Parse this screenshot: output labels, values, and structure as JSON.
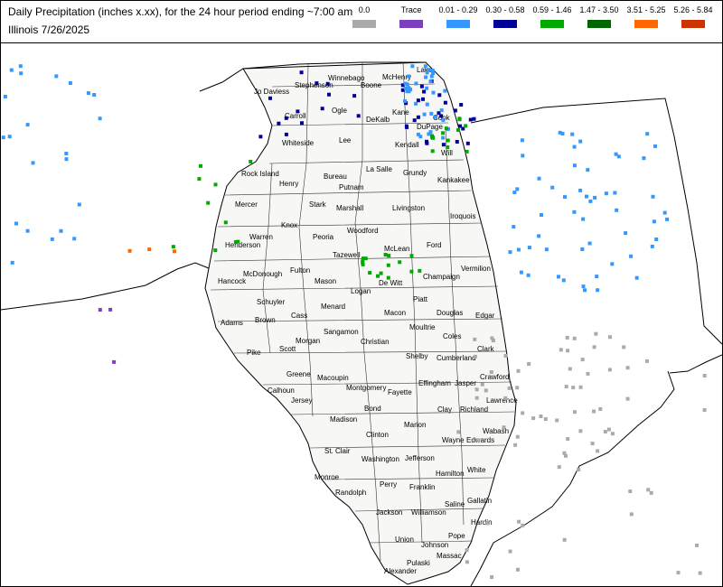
{
  "header": {
    "title": "Daily Precipitation (inches  x.xx),  for the 24 hour period ending ~7:00 am",
    "subtitle": "Illinois 7/26/2025"
  },
  "legend": [
    {
      "label": "0.0",
      "color": "#aaaaaa"
    },
    {
      "label": "Trace",
      "color": "#7b3fbf"
    },
    {
      "label": "0.01 - 0.29",
      "color": "#3399ff"
    },
    {
      "label": "0.30 - 0.58",
      "color": "#000099"
    },
    {
      "label": "0.59 - 1.46",
      "color": "#00aa00"
    },
    {
      "label": "1.47 - 3.50",
      "color": "#006600"
    },
    {
      "label": "3.51 - 5.25",
      "color": "#ff6600"
    },
    {
      "label": "5.26 - 5.84",
      "color": "#cc3300"
    }
  ],
  "counties": [
    "Jo Daviess",
    "Stephenson",
    "Winnebago",
    "Boone",
    "McHenry",
    "Lake",
    "Carroll",
    "Ogle",
    "DeKalb",
    "Kane",
    "Cook",
    "Whiteside",
    "Lee",
    "DuPage",
    "Kendall",
    "Will",
    "Rock Island",
    "Henry",
    "Bureau",
    "La Salle",
    "Grundy",
    "Kankakee",
    "Mercer",
    "Stark",
    "Putnam",
    "Marshall",
    "Livingston",
    "Iroquois",
    "Knox",
    "Peoria",
    "Woodford",
    "Warren",
    "Henderson",
    "Tazewell",
    "McLean",
    "Ford",
    "Vermilion",
    "Fulton",
    "McDonough",
    "Hancock",
    "Mason",
    "De Witt",
    "Champaign",
    "Logan",
    "Schuyler",
    "Menard",
    "Piatt",
    "Douglas",
    "Edgar",
    "Cass",
    "Brown",
    "Adams",
    "Macon",
    "Sangamon",
    "Moultrie",
    "Morgan",
    "Scott",
    "Pike",
    "Christian",
    "Coles",
    "Clark",
    "Shelby",
    "Cumberland",
    "Greene",
    "Macoupin",
    "Montgomery",
    "Calhoun",
    "Jersey",
    "Fayette",
    "Effingham",
    "Jasper",
    "Crawford",
    "Lawrence",
    "Richland",
    "Clay",
    "Bond",
    "Madison",
    "Marion",
    "Clinton",
    "Wayne",
    "Edwards",
    "Wabash",
    "St. Clair",
    "Washington",
    "Jefferson",
    "White",
    "Monroe",
    "Hamilton",
    "Randolph",
    "Perry",
    "Franklin",
    "Saline",
    "Gallatin",
    "Jackson",
    "Williamson",
    "Hardin",
    "Union",
    "Johnson",
    "Pope",
    "Massac",
    "Pulaski",
    "Alexander"
  ]
}
